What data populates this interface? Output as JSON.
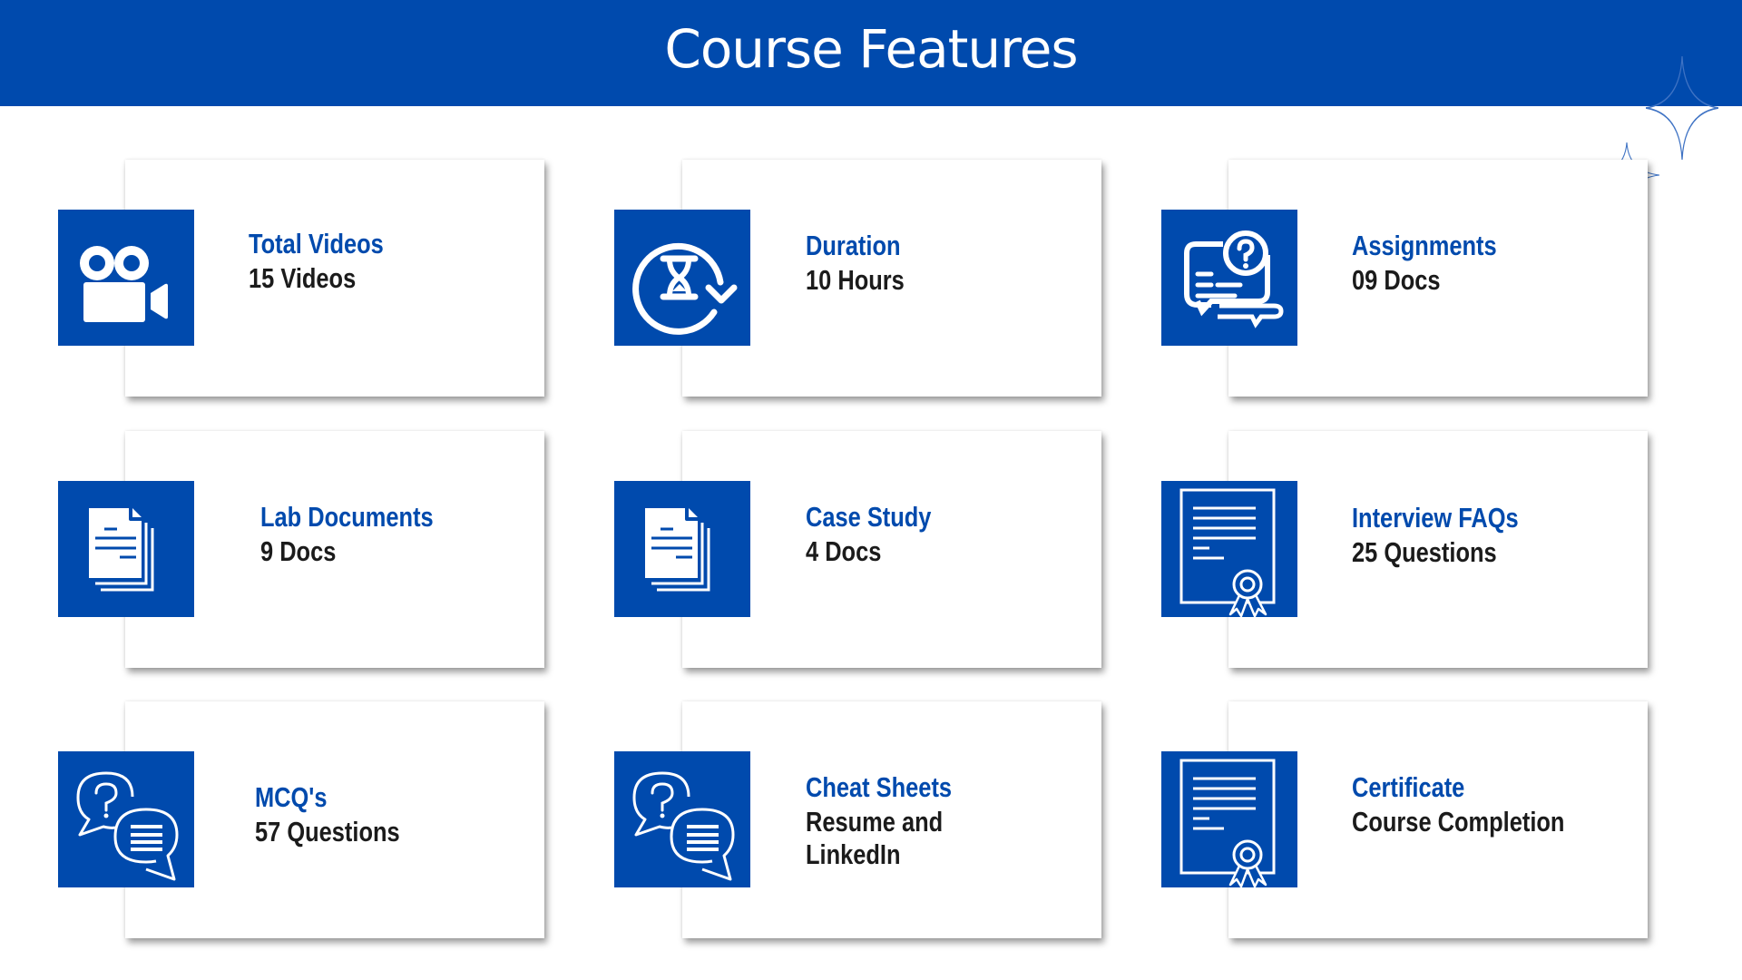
{
  "header": {
    "title": "Course Features",
    "background_color": "#004aad"
  },
  "colors": {
    "accent": "#004aad",
    "value_text": "#1b1b1b",
    "card_background": "#ffffff"
  },
  "features": [
    {
      "label": "Total Videos",
      "value": "15 Videos",
      "icon": "video-camera-icon"
    },
    {
      "label": "Duration",
      "value": "10 Hours",
      "icon": "hourglass-refresh-icon"
    },
    {
      "label": "Assignments",
      "value": "09 Docs",
      "icon": "question-chat-icon"
    },
    {
      "label": "Lab Documents",
      "value": "9 Docs",
      "icon": "documents-icon"
    },
    {
      "label": "Case Study",
      "value": "4 Docs",
      "icon": "documents-icon"
    },
    {
      "label": "Interview FAQs",
      "value": "25 Questions",
      "icon": "certificate-icon"
    },
    {
      "label": "MCQ's",
      "value": "57 Questions",
      "icon": "speech-bubbles-icon"
    },
    {
      "label": "Cheat Sheets",
      "value_lines": [
        "Resume and",
        "LinkedIn"
      ],
      "icon": "speech-bubbles-icon"
    },
    {
      "label": "Certificate",
      "value": "Course Completion",
      "icon": "certificate-icon"
    }
  ]
}
